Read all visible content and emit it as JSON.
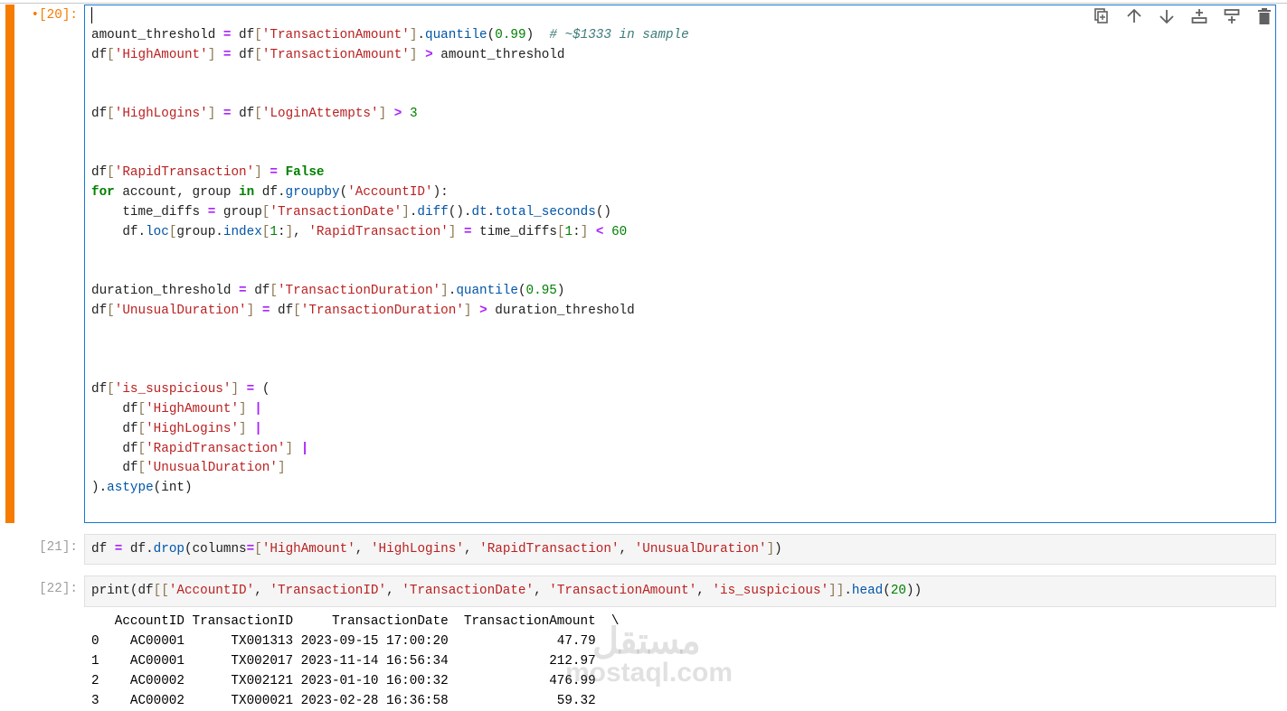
{
  "cells": [
    {
      "prompt": "•[20]:",
      "active": true,
      "lines": [
        [],
        [
          [
            "t",
            "amount_threshold "
          ],
          [
            "o",
            "="
          ],
          [
            "t",
            " df"
          ],
          [
            "b",
            "["
          ],
          [
            "s",
            "'TransactionAmount'"
          ],
          [
            "b",
            "]"
          ],
          [
            "t",
            "."
          ],
          [
            "m",
            "quantile"
          ],
          [
            "t",
            "("
          ],
          [
            "n",
            "0.99"
          ],
          [
            "t",
            ")  "
          ],
          [
            "c",
            "# ~$1333 in sample"
          ]
        ],
        [
          [
            "t",
            "df"
          ],
          [
            "b",
            "["
          ],
          [
            "s",
            "'HighAmount'"
          ],
          [
            "b",
            "]"
          ],
          [
            "t",
            " "
          ],
          [
            "o",
            "="
          ],
          [
            "t",
            " df"
          ],
          [
            "b",
            "["
          ],
          [
            "s",
            "'TransactionAmount'"
          ],
          [
            "b",
            "]"
          ],
          [
            "t",
            " "
          ],
          [
            "o",
            ">"
          ],
          [
            "t",
            " amount_threshold"
          ]
        ],
        [],
        [],
        [
          [
            "t",
            "df"
          ],
          [
            "b",
            "["
          ],
          [
            "s",
            "'HighLogins'"
          ],
          [
            "b",
            "]"
          ],
          [
            "t",
            " "
          ],
          [
            "o",
            "="
          ],
          [
            "t",
            " df"
          ],
          [
            "b",
            "["
          ],
          [
            "s",
            "'LoginAttempts'"
          ],
          [
            "b",
            "]"
          ],
          [
            "t",
            " "
          ],
          [
            "o",
            ">"
          ],
          [
            "t",
            " "
          ],
          [
            "n",
            "3"
          ]
        ],
        [],
        [],
        [
          [
            "t",
            "df"
          ],
          [
            "b",
            "["
          ],
          [
            "s",
            "'RapidTransaction'"
          ],
          [
            "b",
            "]"
          ],
          [
            "t",
            " "
          ],
          [
            "o",
            "="
          ],
          [
            "t",
            " "
          ],
          [
            "k",
            "False"
          ]
        ],
        [
          [
            "k",
            "for"
          ],
          [
            "t",
            " account, group "
          ],
          [
            "k",
            "in"
          ],
          [
            "t",
            " df."
          ],
          [
            "m",
            "groupby"
          ],
          [
            "t",
            "("
          ],
          [
            "s",
            "'AccountID'"
          ],
          [
            "t",
            "):"
          ]
        ],
        [
          [
            "t",
            "    time_diffs "
          ],
          [
            "o",
            "="
          ],
          [
            "t",
            " group"
          ],
          [
            "b",
            "["
          ],
          [
            "s",
            "'TransactionDate'"
          ],
          [
            "b",
            "]"
          ],
          [
            "t",
            "."
          ],
          [
            "m",
            "diff"
          ],
          [
            "t",
            "()."
          ],
          [
            "m",
            "dt"
          ],
          [
            "t",
            "."
          ],
          [
            "m",
            "total_seconds"
          ],
          [
            "t",
            "()"
          ]
        ],
        [
          [
            "t",
            "    df."
          ],
          [
            "m",
            "loc"
          ],
          [
            "b",
            "["
          ],
          [
            "t",
            "group."
          ],
          [
            "m",
            "index"
          ],
          [
            "b",
            "["
          ],
          [
            "n",
            "1"
          ],
          [
            "t",
            ":"
          ],
          [
            "b",
            "]"
          ],
          [
            "t",
            ", "
          ],
          [
            "s",
            "'RapidTransaction'"
          ],
          [
            "b",
            "]"
          ],
          [
            "t",
            " "
          ],
          [
            "o",
            "="
          ],
          [
            "t",
            " time_diffs"
          ],
          [
            "b",
            "["
          ],
          [
            "n",
            "1"
          ],
          [
            "t",
            ":"
          ],
          [
            "b",
            "]"
          ],
          [
            "t",
            " "
          ],
          [
            "o",
            "<"
          ],
          [
            "t",
            " "
          ],
          [
            "n",
            "60"
          ]
        ],
        [],
        [],
        [
          [
            "t",
            "duration_threshold "
          ],
          [
            "o",
            "="
          ],
          [
            "t",
            " df"
          ],
          [
            "b",
            "["
          ],
          [
            "s",
            "'TransactionDuration'"
          ],
          [
            "b",
            "]"
          ],
          [
            "t",
            "."
          ],
          [
            "m",
            "quantile"
          ],
          [
            "t",
            "("
          ],
          [
            "n",
            "0.95"
          ],
          [
            "t",
            ")"
          ]
        ],
        [
          [
            "t",
            "df"
          ],
          [
            "b",
            "["
          ],
          [
            "s",
            "'UnusualDuration'"
          ],
          [
            "b",
            "]"
          ],
          [
            "t",
            " "
          ],
          [
            "o",
            "="
          ],
          [
            "t",
            " df"
          ],
          [
            "b",
            "["
          ],
          [
            "s",
            "'TransactionDuration'"
          ],
          [
            "b",
            "]"
          ],
          [
            "t",
            " "
          ],
          [
            "o",
            ">"
          ],
          [
            "t",
            " duration_threshold"
          ]
        ],
        [],
        [],
        [],
        [
          [
            "t",
            "df"
          ],
          [
            "b",
            "["
          ],
          [
            "s",
            "'is_suspicious'"
          ],
          [
            "b",
            "]"
          ],
          [
            "t",
            " "
          ],
          [
            "o",
            "="
          ],
          [
            "t",
            " ("
          ]
        ],
        [
          [
            "t",
            "    df"
          ],
          [
            "b",
            "["
          ],
          [
            "s",
            "'HighAmount'"
          ],
          [
            "b",
            "]"
          ],
          [
            "t",
            " "
          ],
          [
            "o",
            "|"
          ]
        ],
        [
          [
            "t",
            "    df"
          ],
          [
            "b",
            "["
          ],
          [
            "s",
            "'HighLogins'"
          ],
          [
            "b",
            "]"
          ],
          [
            "t",
            " "
          ],
          [
            "o",
            "|"
          ]
        ],
        [
          [
            "t",
            "    df"
          ],
          [
            "b",
            "["
          ],
          [
            "s",
            "'RapidTransaction'"
          ],
          [
            "b",
            "]"
          ],
          [
            "t",
            " "
          ],
          [
            "o",
            "|"
          ]
        ],
        [
          [
            "t",
            "    df"
          ],
          [
            "b",
            "["
          ],
          [
            "s",
            "'UnusualDuration'"
          ],
          [
            "b",
            "]"
          ]
        ],
        [
          [
            "t",
            ")."
          ],
          [
            "m",
            "astype"
          ],
          [
            "t",
            "(int)"
          ]
        ]
      ]
    },
    {
      "prompt": "[21]:",
      "active": false,
      "lines": [
        [
          [
            "t",
            "df "
          ],
          [
            "o",
            "="
          ],
          [
            "t",
            " df."
          ],
          [
            "m",
            "drop"
          ],
          [
            "t",
            "(columns"
          ],
          [
            "o",
            "="
          ],
          [
            "b",
            "["
          ],
          [
            "s",
            "'HighAmount'"
          ],
          [
            "t",
            ", "
          ],
          [
            "s",
            "'HighLogins'"
          ],
          [
            "t",
            ", "
          ],
          [
            "s",
            "'RapidTransaction'"
          ],
          [
            "t",
            ", "
          ],
          [
            "s",
            "'UnusualDuration'"
          ],
          [
            "b",
            "]"
          ],
          [
            "t",
            ")"
          ]
        ]
      ]
    },
    {
      "prompt": "[22]:",
      "active": false,
      "lines": [
        [
          [
            "t",
            "print(df"
          ],
          [
            "b",
            "[["
          ],
          [
            "s",
            "'AccountID'"
          ],
          [
            "t",
            ", "
          ],
          [
            "s",
            "'TransactionID'"
          ],
          [
            "t",
            ", "
          ],
          [
            "s",
            "'TransactionDate'"
          ],
          [
            "t",
            ", "
          ],
          [
            "s",
            "'TransactionAmount'"
          ],
          [
            "t",
            ", "
          ],
          [
            "s",
            "'is_suspicious'"
          ],
          [
            "b",
            "]]"
          ],
          [
            "t",
            "."
          ],
          [
            "m",
            "head"
          ],
          [
            "t",
            "("
          ],
          [
            "n",
            "20"
          ],
          [
            "t",
            "))"
          ]
        ]
      ]
    }
  ],
  "output": {
    "lines": [
      "   AccountID TransactionID     TransactionDate  TransactionAmount  \\",
      "0    AC00001      TX001313 2023-09-15 17:00:20              47.79",
      "1    AC00001      TX002017 2023-11-14 16:56:34             212.97",
      "2    AC00002      TX002121 2023-01-10 16:00:32             476.99",
      "3    AC00002      TX000021 2023-02-28 16:36:58              59.32"
    ]
  },
  "toolbar": {
    "icons": [
      "duplicate-icon",
      "move-up-icon",
      "move-down-icon",
      "insert-above-icon",
      "insert-below-icon",
      "delete-icon"
    ]
  },
  "watermark": {
    "arabic": "مستقل",
    "latin": "mostaql.com"
  }
}
